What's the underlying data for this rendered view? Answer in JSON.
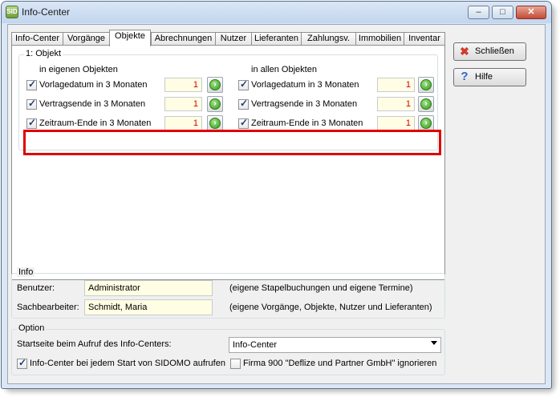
{
  "window": {
    "title": "Info-Center",
    "icon_text": "SID"
  },
  "titlebar_buttons": {
    "minimize": "–",
    "maximize": "□",
    "close": "✕"
  },
  "tabs": [
    {
      "label": "Info-Center"
    },
    {
      "label": "Vorgänge"
    },
    {
      "label": "Objekte"
    },
    {
      "label": "Abrechnungen"
    },
    {
      "label": "Nutzer"
    },
    {
      "label": "Lieferanten"
    },
    {
      "label": "Zahlungsv."
    },
    {
      "label": "Immobilien"
    },
    {
      "label": "Inventar"
    }
  ],
  "active_tab": "Objekte",
  "objekt": {
    "legend": "1: Objekt",
    "left_heading": "in eigenen Objekten",
    "right_heading": "in allen Objekten",
    "left_rows": [
      {
        "label": "Vorlagedatum in 3 Monaten",
        "checked": true,
        "value": "1"
      },
      {
        "label": "Vertragsende in 3 Monaten",
        "checked": true,
        "value": "1"
      },
      {
        "label": "Zeitraum-Ende in 3 Monaten",
        "checked": true,
        "value": "1"
      }
    ],
    "right_rows": [
      {
        "label": "Vorlagedatum in 3 Monaten",
        "checked": true,
        "value": "1"
      },
      {
        "label": "Vertragsende in 3 Monaten",
        "checked": true,
        "value": "1"
      },
      {
        "label": "Zeitraum-Ende in 3 Monaten",
        "checked": true,
        "value": "1"
      }
    ]
  },
  "info": {
    "legend": "Info",
    "benutzer_label": "Benutzer:",
    "benutzer_value": "Administrator",
    "benutzer_note": "(eigene Stapelbuchungen und eigene Termine)",
    "sachbearbeiter_label": "Sachbearbeiter:",
    "sachbearbeiter_value": "Schmidt, Maria",
    "sachbearbeiter_note": "(eigene Vorgänge, Objekte, Nutzer und Lieferanten)"
  },
  "option": {
    "legend": "Option",
    "startseite_label": "Startseite beim Aufruf des Info-Centers:",
    "startseite_value": "Info-Center",
    "start_checkbox_label": "Info-Center bei jedem Start von SIDOMO aufrufen",
    "start_checkbox_checked": true,
    "firma_checkbox_label": "Firma 900 \"Deflize und Partner GmbH\" ignorieren",
    "firma_checkbox_checked": false
  },
  "buttons": {
    "close_label": "Schließen",
    "help_label": "Hilfe"
  },
  "colors": {
    "highlight": "#e00000",
    "field_value": "#d40000",
    "field_bg": "#fffde3"
  }
}
